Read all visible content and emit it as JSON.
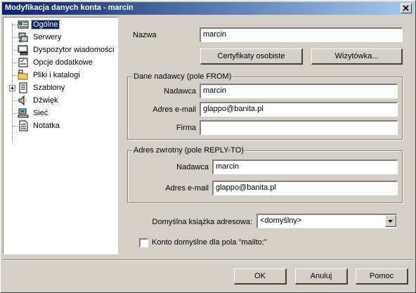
{
  "window": {
    "title": "Modyfikacja danych konta - marcin"
  },
  "tree": {
    "items": [
      {
        "label": "Ogólne",
        "icon": "general-card-icon",
        "selected": true
      },
      {
        "label": "Serwery",
        "icon": "servers-icon"
      },
      {
        "label": "Dyspozytor wiadomości",
        "icon": "dispatcher-icon"
      },
      {
        "label": "Opcje dodatkowe",
        "icon": "options-icon"
      },
      {
        "label": "Pliki i katalogi",
        "icon": "folders-icon"
      },
      {
        "label": "Szablony",
        "icon": "templates-icon",
        "expander": "+"
      },
      {
        "label": "Dźwięk",
        "icon": "speaker-icon"
      },
      {
        "label": "Sieć",
        "icon": "network-icon"
      },
      {
        "label": "Notatka",
        "icon": "note-icon"
      }
    ]
  },
  "general": {
    "name_label": "Nazwa",
    "name_value": "marcin",
    "certificates_button": "Certyfikaty osobiste",
    "vcard_button": "Wizytówka..."
  },
  "from_group": {
    "title": "Dane nadawcy (pole FROM)",
    "sender_label": "Nadawca",
    "sender_value": "marcin",
    "email_label": "Adres e-mail",
    "email_value": "glappo@banita.pl",
    "company_label": "Firma",
    "company_value": ""
  },
  "reply_group": {
    "title": "Adres zwrotny (pole REPLY-TO)",
    "sender_label": "Nadawca",
    "sender_value": "marcin",
    "email_label": "Adres e-mail",
    "email_value": "glappo@banita.pl"
  },
  "addressbook": {
    "label": "Domyślna książka adresowa:",
    "value": "<domyślny>"
  },
  "mailto": {
    "label": "Konto domyślne dla pola \"mailto:\"",
    "checked": false
  },
  "buttons": {
    "ok": "OK",
    "cancel": "Anuluj",
    "help": "Pomoc"
  }
}
